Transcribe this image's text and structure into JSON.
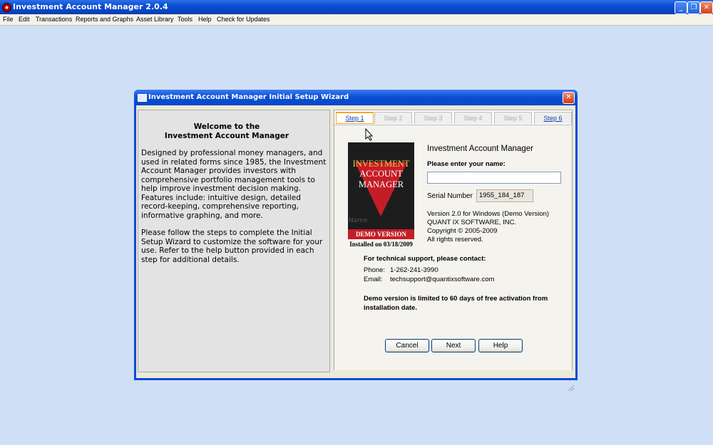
{
  "window": {
    "title": "Investment Account Manager 2.0.4",
    "minimize_icon": "minimize-icon",
    "maximize_icon": "restore-icon",
    "close_icon": "close-icon"
  },
  "menu": [
    "File",
    "Edit",
    "Transactions",
    "Reports and Graphs",
    "Asset Library",
    "Tools",
    "Help",
    "Check for Updates"
  ],
  "dialog": {
    "title": "Investment Account Manager Initial Setup Wizard",
    "welcome": {
      "heading_line1": "Welcome to the",
      "heading_line2": "Investment Account Manager",
      "paragraph1": "Designed by professional money managers, and used in related forms since 1985, the Investment Account Manager provides investors with comprehensive portfolio management tools to help improve investment decision making. Features include: intuitive design, detailed record-keeping, comprehensive reporting, informative graphing, and more.",
      "paragraph2": "Please follow the steps to complete the Initial Setup Wizard to customize the software for your use.  Refer to the help button provided in each step for additional details."
    },
    "tabs": [
      "Step 1",
      "Step 2",
      "Step 3",
      "Step 4",
      "Step 5",
      "Step 6"
    ],
    "active_tab": "Step 1",
    "logo": {
      "line1": "INVESTMENT",
      "line2": "ACCOUNT",
      "line3": "MANAGER",
      "ghost": "Name",
      "demo_band": "DEMO VERSION",
      "installed": "Installed on 03/18/2009"
    },
    "product_name": "Investment Account Manager",
    "name_label": "Please enter your name:",
    "name_value": "",
    "serial_label": "Serial Number",
    "serial_value": "1955_184_187",
    "version_line1": "Version 2.0 for Windows  (Demo Version)",
    "version_line2": "QUANT IX SOFTWARE, INC.",
    "version_line3": "Copyright © 2005-2009",
    "version_line4": "All rights reserved.",
    "support_heading": "For technical support, please contact:",
    "phone_label": "Phone:",
    "phone_value": "1-262-241-3990",
    "email_label": "Email:",
    "email_value": "techsupport@quantixsoftware.com",
    "demo_note": "Demo version is limited to 60 days of free activation from installation date.",
    "buttons": {
      "cancel": "Cancel",
      "next": "Next",
      "help": "Help"
    }
  },
  "colors": {
    "desktop": "#cfdff5",
    "titlebar": "#0a4fd3",
    "logo_red": "#c51d26",
    "logo_bg": "#1d1d1d",
    "active_tab_border": "#f5a623"
  }
}
